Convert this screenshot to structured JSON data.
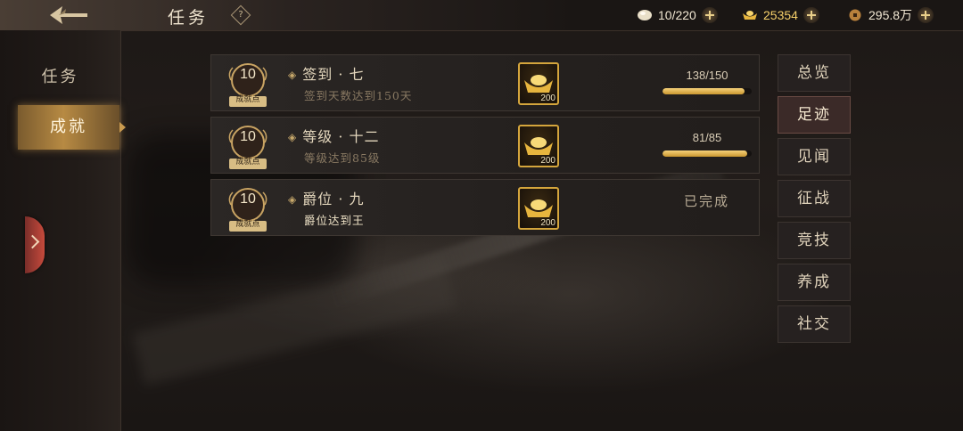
{
  "header": {
    "title": "任务",
    "help_label": "?"
  },
  "resources": [
    {
      "icon": "food-icon",
      "value": "10/220"
    },
    {
      "icon": "gold-ingot-icon",
      "value": "25354"
    },
    {
      "icon": "coin-icon",
      "value": "295.8万"
    }
  ],
  "left_nav": {
    "items": [
      {
        "label": "任务",
        "active": false
      },
      {
        "label": "成就",
        "active": true
      }
    ]
  },
  "achievements": [
    {
      "points": "10",
      "points_label": "成就点",
      "title": "签到 · 七",
      "description": "签到天数达到150天",
      "reward_icon": "gold-ingot-icon",
      "reward_count": "200",
      "status": "in_progress",
      "progress_text": "138/150",
      "progress_fraction": 0.92
    },
    {
      "points": "10",
      "points_label": "成就点",
      "title": "等级 · 十二",
      "description": "等级达到85级",
      "reward_icon": "gold-ingot-icon",
      "reward_count": "200",
      "status": "in_progress",
      "progress_text": "81/85",
      "progress_fraction": 0.953
    },
    {
      "points": "10",
      "points_label": "成就点",
      "title": "爵位 · 九",
      "description": "爵位达到王",
      "reward_icon": "gold-ingot-icon",
      "reward_count": "200",
      "status": "completed",
      "status_text": "已完成"
    }
  ],
  "right_nav": {
    "items": [
      {
        "label": "总览",
        "active": false
      },
      {
        "label": "足迹",
        "active": true
      },
      {
        "label": "见闻",
        "active": false
      },
      {
        "label": "征战",
        "active": false
      },
      {
        "label": "竞技",
        "active": false
      },
      {
        "label": "养成",
        "active": false
      },
      {
        "label": "社交",
        "active": false
      }
    ]
  },
  "colors": {
    "accent_gold": "#d4a53c",
    "progress_fill": "#e8bb52",
    "side_handle": "#c64a3c"
  }
}
